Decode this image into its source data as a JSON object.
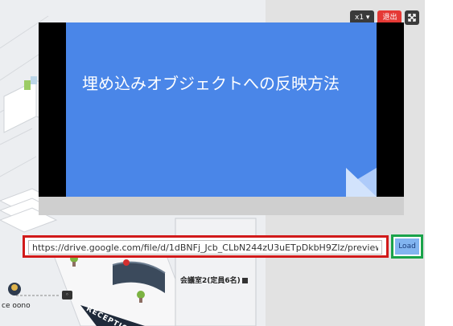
{
  "controls": {
    "speed_label": "x1 ▾",
    "exit_label": "退出",
    "expand_icon": "expand-icon"
  },
  "slide": {
    "title": "埋め込みオブジェクトへの反映方法",
    "background_color": "#4a86e8"
  },
  "url_field": {
    "value": "https://drive.google.com/file/d/1dBNFj_Jcb_CLbN244zU3uETpDkbH9Zlz/preview"
  },
  "load_button": {
    "label": "Load"
  },
  "map": {
    "room_label": "会議室2(定員6名)",
    "user_label": "ce oono",
    "reception_label": "RECEPTION"
  },
  "highlights": {
    "url_border": "#d11a1a",
    "load_border": "#1aa34a"
  }
}
